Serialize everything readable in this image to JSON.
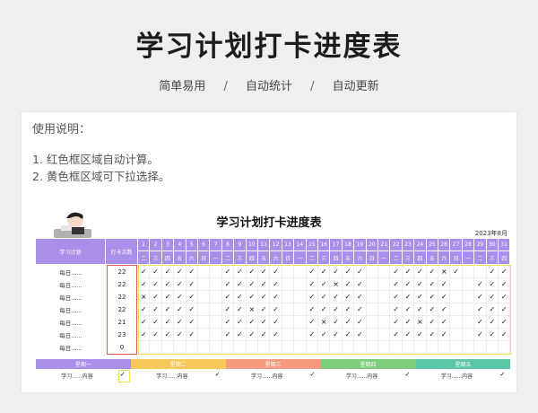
{
  "hero": {
    "title": "学习计划打卡进度表"
  },
  "features": [
    "简单易用",
    "自动统计",
    "自动更新"
  ],
  "separator": "/",
  "instructions": {
    "title": "使用说明：",
    "lines": [
      "1. 红色框区域自动计算。",
      "2. 黄色框区域可下拉选择。"
    ]
  },
  "sheet": {
    "title": "学习计划打卡进度表",
    "month": "2023年8月",
    "col_plan": "学习计划",
    "col_count": "打卡次数",
    "days": [
      "1",
      "2",
      "3",
      "4",
      "5",
      "6",
      "7",
      "8",
      "9",
      "10",
      "11",
      "12",
      "13",
      "14",
      "15",
      "16",
      "17",
      "18",
      "19",
      "20",
      "21",
      "22",
      "23",
      "24",
      "25",
      "26",
      "27",
      "28",
      "29",
      "30",
      "31"
    ],
    "weekdays": [
      "二",
      "三",
      "四",
      "五",
      "六",
      "日",
      "一",
      "二",
      "三",
      "四",
      "五",
      "六",
      "日",
      "一",
      "二",
      "三",
      "四",
      "五",
      "六",
      "日",
      "一",
      "二",
      "三",
      "四",
      "五",
      "六",
      "日",
      "一",
      "二",
      "三",
      "四"
    ],
    "rows": [
      {
        "label": "每日......",
        "count": "22",
        "marks": "✓✓✓✓✓  ✓✓✓✓✓  ✓✓✓✓✓  ✓✓✓✓×✓  ✓✓✓"
      },
      {
        "label": "每日......",
        "count": "22",
        "marks": "✓✓✓✓✓  ✓✓✓✓✓  ✓✓×✓✓  ✓✓✓✓✓  ✓✓✓"
      },
      {
        "label": "每日......",
        "count": "22",
        "marks": "×✓✓✓✓  ✓✓✓✓✓  ✓✓✓✓✓  ✓✓✓✓✓  ✓✓✓"
      },
      {
        "label": "每日......",
        "count": "22",
        "marks": "✓✓✓✓✓  ✓✓×✓✓  ✓✓✓✓✓  ✓✓✓✓✓  ✓✓✓"
      },
      {
        "label": "每日......",
        "count": "21",
        "marks": "✓✓✓✓✓  ✓✓✓✓✓  ✓×✓✓✓  ✓✓×✓✓  ✓✓✓"
      },
      {
        "label": "每日......",
        "count": "23",
        "marks": "✓✓✓✓✓  ✓✓✓✓✓  ✓✓✓✓✓  ✓✓✓✓✓  ✓✓✓"
      },
      {
        "label": "每日......",
        "count": "0",
        "marks": "                               "
      }
    ],
    "weeks": [
      {
        "label": "星期一",
        "color": "#a98fe9"
      },
      {
        "label": "星期二",
        "color": "#f7c85a"
      },
      {
        "label": "星期三",
        "color": "#f49a7e"
      },
      {
        "label": "星期四",
        "color": "#7cce7a"
      },
      {
        "label": "星期五",
        "color": "#5cc6a8"
      }
    ],
    "study_label": "学习......内容",
    "check": "✓"
  }
}
